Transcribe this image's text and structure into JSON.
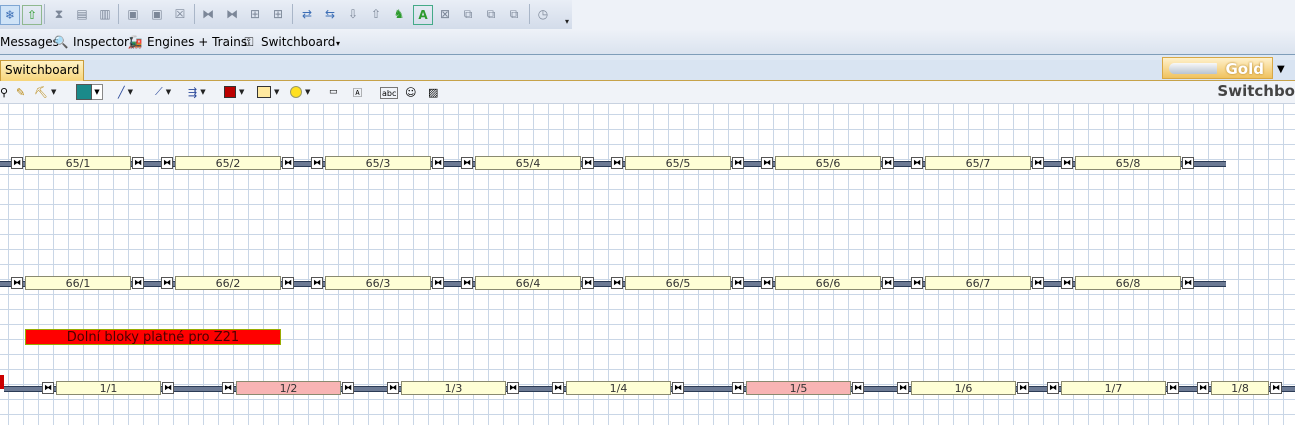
{
  "toolbar": {
    "icons": [
      "snowflake-icon",
      "up-arrow-icon",
      "hourglass-icon",
      "print-icon",
      "mode-icon",
      "loco-icon",
      "loco2-icon",
      "loco3-icon",
      "route1-icon",
      "route2-icon",
      "route3-icon",
      "route4-icon",
      "switch1-icon",
      "switch2-icon",
      "down-icon",
      "up-icon",
      "figure-icon",
      "text-a-icon",
      "split-icon",
      "copy1-icon",
      "copy2-icon",
      "copy3-icon",
      "clock-icon"
    ]
  },
  "panels": [
    {
      "label": "Messages",
      "icon": "messages-icon"
    },
    {
      "label": "Inspector",
      "icon": "inspector-icon"
    },
    {
      "label": "Engines + Trains",
      "icon": "engines-icon"
    },
    {
      "label": "Switchboard",
      "icon": "switchboard-icon"
    }
  ],
  "tab": {
    "label": "Switchboard"
  },
  "brand": {
    "label": "Gold"
  },
  "switchboard_title": "Switchbo",
  "rows": [
    {
      "blocks": [
        {
          "label": "65/1",
          "occupied": false
        },
        {
          "label": "65/2",
          "occupied": false
        },
        {
          "label": "65/3",
          "occupied": false
        },
        {
          "label": "65/4",
          "occupied": false
        },
        {
          "label": "65/5",
          "occupied": false
        },
        {
          "label": "65/6",
          "occupied": false
        },
        {
          "label": "65/7",
          "occupied": false
        },
        {
          "label": "65/8",
          "occupied": false
        }
      ]
    },
    {
      "blocks": [
        {
          "label": "66/1",
          "occupied": false
        },
        {
          "label": "66/2",
          "occupied": false
        },
        {
          "label": "66/3",
          "occupied": false
        },
        {
          "label": "66/4",
          "occupied": false
        },
        {
          "label": "66/5",
          "occupied": false
        },
        {
          "label": "66/6",
          "occupied": false
        },
        {
          "label": "66/7",
          "occupied": false
        },
        {
          "label": "66/8",
          "occupied": false
        }
      ]
    },
    {
      "blocks": [
        {
          "label": "1/1",
          "occupied": false
        },
        {
          "label": "1/2",
          "occupied": true
        },
        {
          "label": "1/3",
          "occupied": false
        },
        {
          "label": "1/4",
          "occupied": false
        },
        {
          "label": "1/5",
          "occupied": true
        },
        {
          "label": "1/6",
          "occupied": false
        },
        {
          "label": "1/7",
          "occupied": false
        },
        {
          "label": "1/8",
          "occupied": false
        }
      ]
    }
  ],
  "note_label": "Dolní bloky platné pro Z21"
}
